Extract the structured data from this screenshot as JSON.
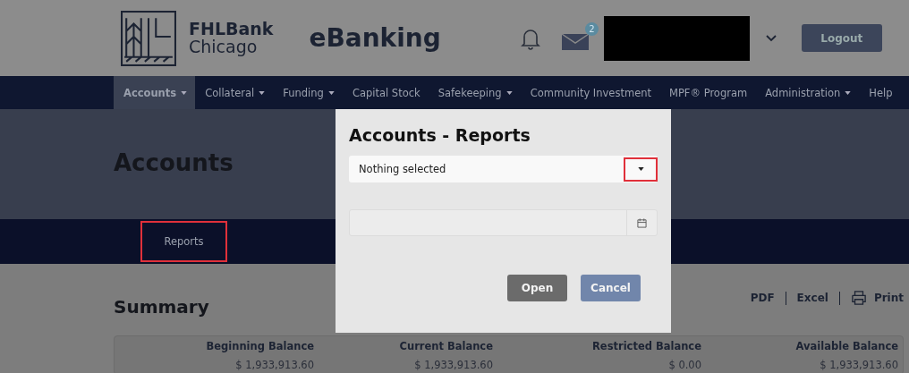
{
  "header": {
    "brand_line_1": "FHLBank",
    "brand_line_2": "Chicago",
    "product": "eBanking",
    "message_count": "2",
    "logout": "Logout"
  },
  "nav": [
    {
      "label": "Accounts",
      "caret": true,
      "selected": true
    },
    {
      "label": "Collateral",
      "caret": true,
      "selected": false
    },
    {
      "label": "Funding",
      "caret": true,
      "selected": false
    },
    {
      "label": "Capital Stock",
      "caret": false,
      "selected": false
    },
    {
      "label": "Safekeeping",
      "caret": true,
      "selected": false
    },
    {
      "label": "Community Investment",
      "caret": false,
      "selected": false
    },
    {
      "label": "MPF® Program",
      "caret": false,
      "selected": false
    },
    {
      "label": "Administration",
      "caret": true,
      "selected": false
    },
    {
      "label": "Help",
      "caret": false,
      "selected": false
    }
  ],
  "page_title": "Accounts",
  "subnav": [
    {
      "label": "Reports",
      "highlighted": true
    }
  ],
  "summary": {
    "title": "Summary",
    "exports": [
      "PDF",
      "Excel"
    ],
    "print": "Print",
    "columns": [
      "Beginning Balance",
      "Current Balance",
      "Restricted Balance",
      "Available Balance"
    ],
    "rows": [
      [
        "$ 1,933,913.60",
        "$ 1,933,913.60",
        "$ 0.00",
        "$ 1,933,913.60"
      ]
    ]
  },
  "dialog": {
    "title": "Accounts - Reports",
    "select_value": "Nothing selected",
    "caret_highlighted": true,
    "buttons": [
      {
        "label": "Open",
        "kind": "primary"
      },
      {
        "label": "Cancel",
        "kind": "secondary"
      }
    ]
  }
}
